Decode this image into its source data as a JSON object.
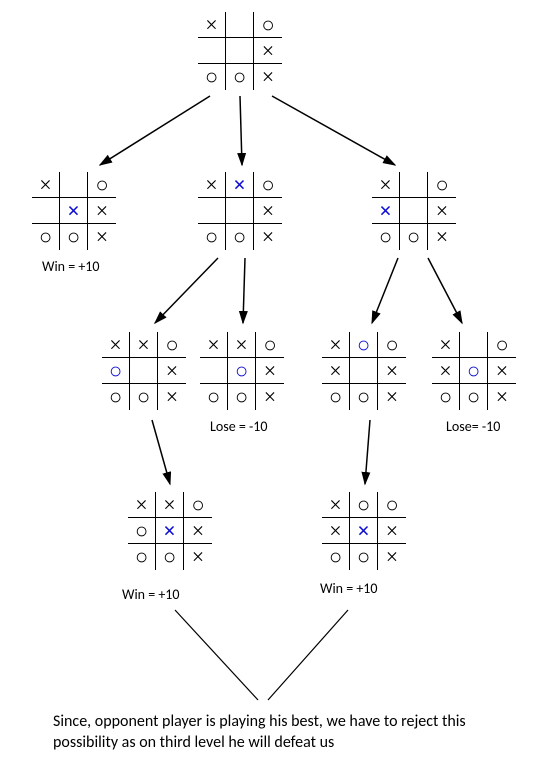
{
  "labels": {
    "win": "Win = +10",
    "lose": "Lose = -10",
    "lose2": "Lose= -10",
    "win2": "Win = +10",
    "win3": "Win = +10"
  },
  "caption": "Since, opponent player is playing his best, we have to reject this possibility as on third level he will defeat us",
  "chart_data": {
    "type": "tree",
    "description": "Minimax game tree for tic-tac-toe position",
    "mark_legend": {
      "x": "X (black)",
      "o": "O (black)",
      "bx": "X (blue, new move)",
      "bo": "O (blue, new move)",
      "": "empty"
    },
    "root": {
      "board": [
        "x",
        "",
        "o",
        "",
        "",
        "x",
        "o",
        "o",
        "x"
      ],
      "children": [
        {
          "board": [
            "x",
            "",
            "o",
            "",
            "bx",
            "x",
            "o",
            "o",
            "x"
          ],
          "score": 10,
          "scoreLabel": "Win = +10"
        },
        {
          "board": [
            "x",
            "bx",
            "o",
            "",
            "",
            "x",
            "o",
            "o",
            "x"
          ],
          "children": [
            {
              "board": [
                "x",
                "x",
                "o",
                "bo",
                "",
                "x",
                "o",
                "o",
                "x"
              ],
              "children": [
                {
                  "board": [
                    "x",
                    "x",
                    "o",
                    "o",
                    "bx",
                    "x",
                    "o",
                    "o",
                    "x"
                  ],
                  "score": 10,
                  "scoreLabel": "Win = +10",
                  "rejected": true
                }
              ]
            },
            {
              "board": [
                "x",
                "x",
                "o",
                "",
                "bo",
                "x",
                "o",
                "o",
                "x"
              ],
              "score": -10,
              "scoreLabel": "Lose = -10"
            }
          ]
        },
        {
          "board": [
            "x",
            "",
            "o",
            "bx",
            "",
            "x",
            "o",
            "o",
            "x"
          ],
          "children": [
            {
              "board": [
                "x",
                "bo",
                "o",
                "x",
                "",
                "x",
                "o",
                "o",
                "x"
              ],
              "children": [
                {
                  "board": [
                    "x",
                    "o",
                    "o",
                    "x",
                    "bx",
                    "x",
                    "o",
                    "o",
                    "x"
                  ],
                  "score": 10,
                  "scoreLabel": "Win = +10",
                  "rejected": true
                }
              ]
            },
            {
              "board": [
                "x",
                "",
                "o",
                "x",
                "bo",
                "x",
                "o",
                "o",
                "x"
              ],
              "score": -10,
              "scoreLabel": "Lose= -10"
            }
          ]
        }
      ]
    },
    "rejection_note": "Since, opponent player is playing his best, we have to reject this possibility as on third level he will defeat us"
  }
}
